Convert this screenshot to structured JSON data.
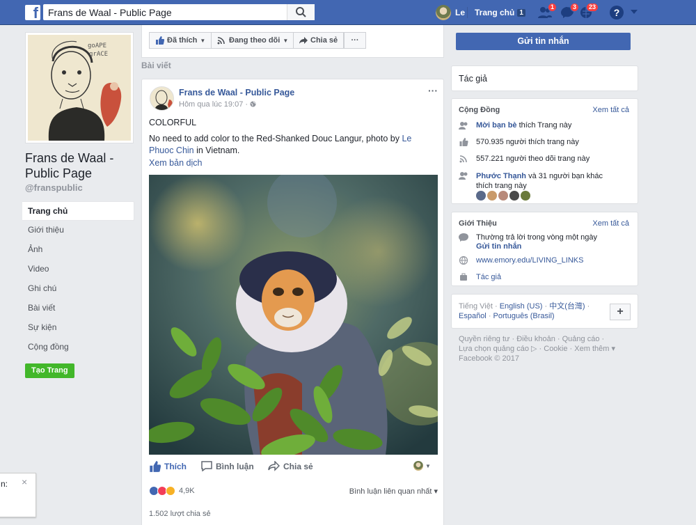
{
  "topbar": {
    "logo": "f",
    "search_value": "Frans de Waal - Public Page",
    "user_name": "Le",
    "home_label": "Trang chủ",
    "home_count": "1",
    "friend_requests": "1",
    "messages": "3",
    "notifications": "23",
    "help": "?",
    "brand_color": "#4267b2"
  },
  "left": {
    "page_name": "Frans de Waal - Public Page",
    "handle": "@franspublic",
    "nav": [
      {
        "label": "Trang chủ"
      },
      {
        "label": "Giới thiệu"
      },
      {
        "label": "Ảnh"
      },
      {
        "label": "Video"
      },
      {
        "label": "Ghi chú"
      },
      {
        "label": "Bài viết"
      },
      {
        "label": "Sự kiện"
      },
      {
        "label": "Cộng đồng"
      }
    ],
    "create_page": "Tạo Trang"
  },
  "actions": {
    "like": "Đã thích",
    "following": "Đang theo dõi",
    "share": "Chia sẻ",
    "more": "···",
    "send_message": "Gửi tin nhắn"
  },
  "section_label": "Bài viết",
  "post": {
    "author": "Frans de Waal - Public Page",
    "time": "Hôm qua lúc 19:07 · ",
    "menu": "···",
    "title": "COLORFUL",
    "text_before": "No need to add color to the Red-Shanked Douc Langur, photo by ",
    "credit": "Le Phuoc Chin",
    "text_after": " in Vietnam.",
    "translate": "Xem bản dịch",
    "like": "Thích",
    "comment": "Bình luận",
    "share": "Chia sẻ",
    "reactions_count": "4,9K",
    "comment_sort": "Bình luận liên quan nhất ▾",
    "shares": "1.502 lượt chia sẻ"
  },
  "right": {
    "author_card": "Tác giả",
    "community": {
      "title": "Cộng Đồng",
      "see_all": "Xem tất cả",
      "invite_link": "Mời bạn bè",
      "invite_rest": " thích Trang này",
      "likes": "570.935 người thích trang này",
      "follows": "557.221 người theo dõi trang này",
      "friend_name": "Phước Thạnh",
      "friends_rest": " và 31 người bạn khác thích trang này"
    },
    "about": {
      "title": "Giới Thiệu",
      "see_all": "Xem tất cả",
      "response": "Thường trả lời trong vòng một ngày",
      "send_message": "Gửi tin nhắn",
      "website": "www.emory.edu/LIVING_LINKS",
      "category": "Tác giả"
    },
    "languages": {
      "current": "Tiếng Việt",
      "sep": " · ",
      "english": "English (US)",
      "chinese": "中文(台灣)",
      "spanish": "Español",
      "portuguese": "Português (Brasil)",
      "plus": "+"
    },
    "footer": {
      "privacy": "Quyền riêng tư",
      "terms": "Điều khoản",
      "ads": "Quảng cáo",
      "adchoices": "Lựa chọn quảng cáo",
      "cookie": "Cookie",
      "more": "Xem thêm ▾",
      "copyright": "Facebook © 2017"
    }
  },
  "chat_popup": {
    "text": "n:",
    "close": "×"
  }
}
